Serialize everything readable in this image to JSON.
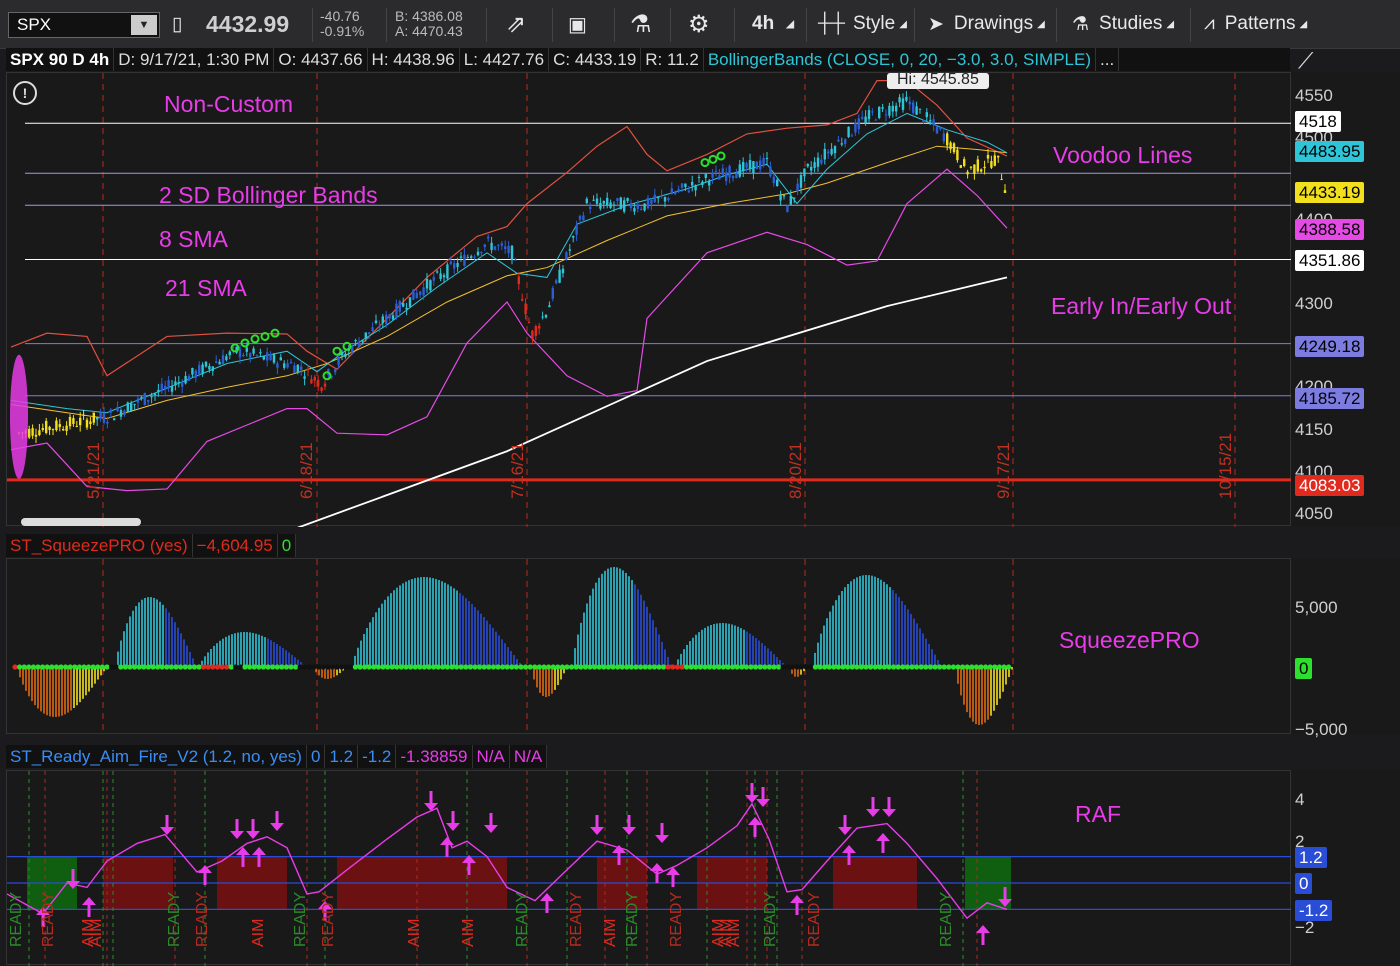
{
  "toolbar": {
    "symbol": "SPX",
    "price": "4432.99",
    "change": "-40.76",
    "change_pct": "-0.91%",
    "bid": "B: 4386.08",
    "ask": "A: 4470.43",
    "aggregation": "4h",
    "style_label": "Style",
    "drawings_label": "Drawings",
    "studies_label": "Studies",
    "patterns_label": "Patterns"
  },
  "infobar": {
    "title": "SPX 90 D 4h",
    "date": "D: 9/17/21, 1:30 PM",
    "open": "O: 4437.66",
    "high": "H: 4438.96",
    "low": "L: 4427.76",
    "close": "C: 4433.19",
    "range": "R: 11.2",
    "study": "BollingerBands (CLOSE, 0, 20, −3.0, 3.0, SIMPLE)",
    "more": "..."
  },
  "main_chart": {
    "hi_label": "Hi: 4545.85",
    "notes": [
      "Non-Custom",
      "2 SD Bollinger Bands",
      "8 SMA",
      "21 SMA",
      "Voodoo Lines",
      "Early In/Early Out"
    ],
    "date_labels": [
      "5/21/21",
      "6/18/21",
      "7/16/21",
      "8/20/21",
      "9/17/21",
      "10/15/21"
    ],
    "axis_ticks": [
      "4550",
      "4500",
      "4450",
      "4400",
      "4350",
      "4300",
      "4250",
      "4200",
      "4150",
      "4100",
      "4050"
    ],
    "price_tags": [
      {
        "text": "4518",
        "bg": "#ffffff",
        "fg": "#000000"
      },
      {
        "text": "4483.95",
        "bg": "#2ec5d8",
        "fg": "#000000"
      },
      {
        "text": "4433.19",
        "bg": "#f2e01f",
        "fg": "#000000"
      },
      {
        "text": "4388.58",
        "bg": "#e64ae6",
        "fg": "#000000"
      },
      {
        "text": "4351.86",
        "bg": "#ffffff",
        "fg": "#000000"
      },
      {
        "text": "4249.18",
        "bg": "#7c7ce0",
        "fg": "#000000"
      },
      {
        "text": "4185.72",
        "bg": "#7c7ce0",
        "fg": "#000000"
      },
      {
        "text": "4083.03",
        "bg": "#e02a1e",
        "fg": "#ffffff"
      }
    ]
  },
  "squeeze": {
    "name": "ST_SqueezePRO (yes)",
    "value": "−4,604.95",
    "flag": "0",
    "note": "SqueezePRO",
    "axis_ticks": [
      "5,000",
      "−5,000"
    ],
    "zero_tag": "0"
  },
  "raf": {
    "name": "ST_Ready_Aim_Fire_V2 (1.2, no, yes)",
    "p1": "0",
    "p2": "1.2",
    "p3": "-1.2",
    "value": "-1.38859",
    "na1": "N/A",
    "na2": "N/A",
    "note": "RAF",
    "axis_ticks": [
      "4",
      "2",
      "−2"
    ],
    "tags": [
      "1.2",
      "0",
      "-1.2"
    ],
    "ready_label": "READY",
    "aim_label": "AIM"
  },
  "colors": {
    "accent": "#e83ce8",
    "up_bar": "#2a5fd6",
    "down_bar": "#e02a1e",
    "cyan": "#2ec5d8",
    "yellow": "#f2e01f"
  }
}
